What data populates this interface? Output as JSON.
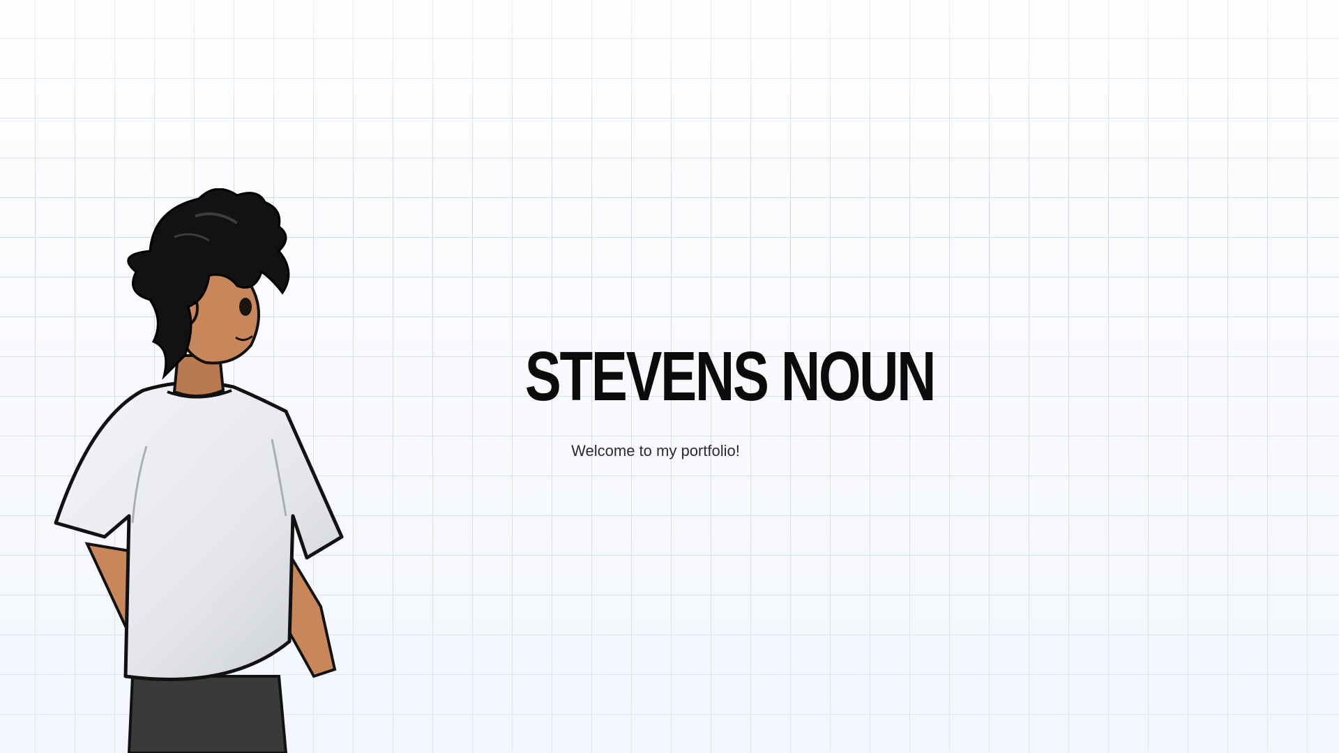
{
  "hero": {
    "name": "STEVENS NOUN",
    "tagline": "Welcome to my portfolio!"
  },
  "illustration": {
    "icon": "anime-boy-character-illustration"
  },
  "colors": {
    "background": "#fbfcfe",
    "grid_line": "#d3d9e4",
    "title_text": "#0b0b0b",
    "tagline_text": "#2b2b2b",
    "hair": "#111111",
    "skin": "#c8875a",
    "shirt": "#e9eaee",
    "pants": "#3a3a3a"
  }
}
